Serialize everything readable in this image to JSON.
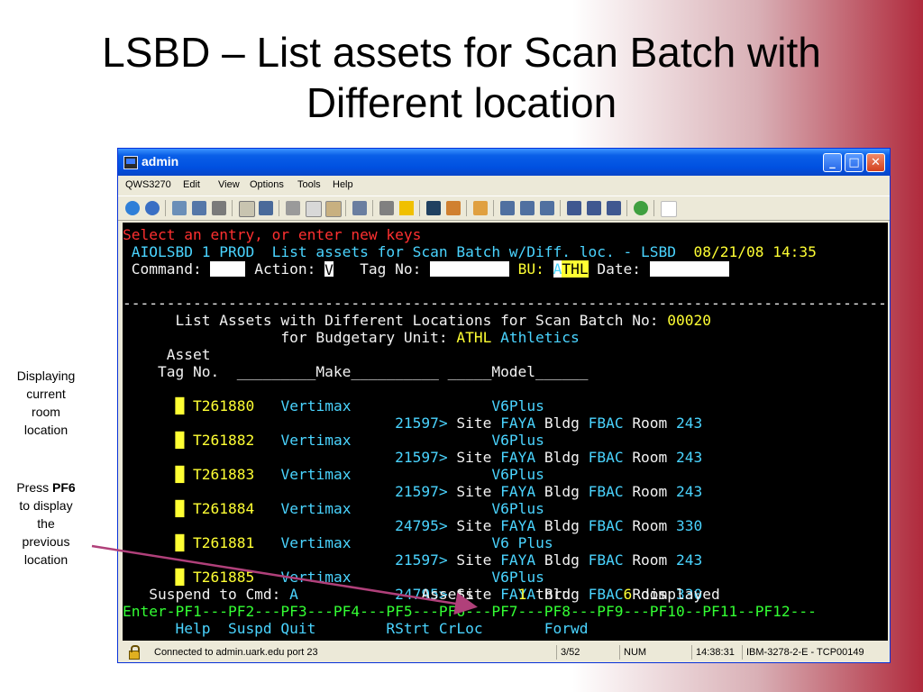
{
  "slide": {
    "title_line1": "LSBD – List assets for Scan Batch with",
    "title_line2": "Different location",
    "note1_lines": [
      "Displaying",
      "current",
      "room",
      "location"
    ],
    "note2_press": "Press ",
    "note2_key": "PF6",
    "note2_lines": [
      "to display",
      "the",
      "previous",
      "location"
    ]
  },
  "window": {
    "title": "admin",
    "min_label": "_",
    "max_label": "□",
    "close_label": "✕"
  },
  "menu": {
    "items": [
      {
        "label": "QWS3270"
      },
      {
        "label": "Edit"
      },
      {
        "label": "View"
      },
      {
        "label": "Options"
      },
      {
        "label": "Tools"
      },
      {
        "label": "Help"
      }
    ]
  },
  "terminal": {
    "line1": "Select an entry, or enter new keys",
    "line2_app": " AIOLSBD 1 PROD  List assets for Scan Batch w/Diff. loc. - LSBD  ",
    "line2_date": "08/21/08 14:35",
    "cmd_label": " Command: ",
    "cmd_value": "    ",
    "action_label": " Action: ",
    "action_value": "V",
    "tag_label": "   Tag No: ",
    "tag_value": "         ",
    "bu_label": " BU: ",
    "bu_value_a": "A",
    "bu_value_rest": "THL",
    "date_label": " Date: ",
    "date_value": "         ",
    "separator": "-------------------------------------------------------------------------------------------",
    "heading1_text": "      List Assets with Different Locations for Scan Batch No: ",
    "heading1_batch": "00020",
    "heading2_text": "                  for Budgetary Unit: ",
    "heading2_bu": "ATHL",
    "heading2_name": " Athletics",
    "col_asset": "     Asset",
    "col_tag": "    Tag No.  _________Make__________ _____Model______",
    "rows": [
      {
        "marker": "█",
        "tag": "T261880",
        "make": "Vertimax",
        "model": "V6Plus",
        "loc_id": "21597>",
        "site_label": "Site",
        "site": "FAYA",
        "bldg_label": "Bldg",
        "bldg": "FBAC",
        "room_label": "Room",
        "room": "243"
      },
      {
        "marker": "█",
        "tag": "T261882",
        "make": "Vertimax",
        "model": "V6Plus",
        "loc_id": "21597>",
        "site_label": "Site",
        "site": "FAYA",
        "bldg_label": "Bldg",
        "bldg": "FBAC",
        "room_label": "Room",
        "room": "243"
      },
      {
        "marker": "█",
        "tag": "T261883",
        "make": "Vertimax",
        "model": "V6Plus",
        "loc_id": "21597>",
        "site_label": "Site",
        "site": "FAYA",
        "bldg_label": "Bldg",
        "bldg": "FBAC",
        "room_label": "Room",
        "room": "243"
      },
      {
        "marker": "█",
        "tag": "T261884",
        "make": "Vertimax",
        "model": "V6Plus",
        "loc_id": "24795>",
        "site_label": "Site",
        "site": "FAYA",
        "bldg_label": "Bldg",
        "bldg": "FBAC",
        "room_label": "Room",
        "room": "330"
      },
      {
        "marker": "█",
        "tag": "T261881",
        "make": "Vertimax",
        "model": "V6 Plus",
        "loc_id": "21597>",
        "site_label": "Site",
        "site": "FAYA",
        "bldg_label": "Bldg",
        "bldg": "FBAC",
        "room_label": "Room",
        "room": "243"
      },
      {
        "marker": "█",
        "tag": "T261885",
        "make": "Vertimax",
        "model": "V6Plus",
        "loc_id": "24795>",
        "site_label": "Site",
        "site": "FAYA",
        "bldg_label": "Bldg",
        "bldg": "FBAC",
        "room_label": "Room",
        "room": "330"
      }
    ],
    "suspend_label": "   Suspend to Cmd: ",
    "suspend_value": "A",
    "assets_label": "              Assets     ",
    "assets_from": "1",
    "thru_label": " thru      ",
    "assets_to": "6",
    "displayed_label": " displayed",
    "pf_line": "Enter-PF1---PF2---PF3---PF4---PF5---PF6---PF7---PF8---PF9---PF10--PF11--PF12---",
    "pf_labels": "      Help  Suspd Quit        RStrt CrLoc       Forwd"
  },
  "statusbar": {
    "connection": "Connected to admin.uark.edu port 23",
    "position": "3/52",
    "num": "NUM",
    "time": "14:38:31",
    "session": "IBM-3278-2-E - TCP00149"
  },
  "colors": {
    "terminal_bg": "#000000",
    "red": "#ff3030",
    "cyan": "#4ad4ff",
    "yellow": "#ffff33",
    "green": "#33ff33",
    "arrow": "#b0407a"
  }
}
